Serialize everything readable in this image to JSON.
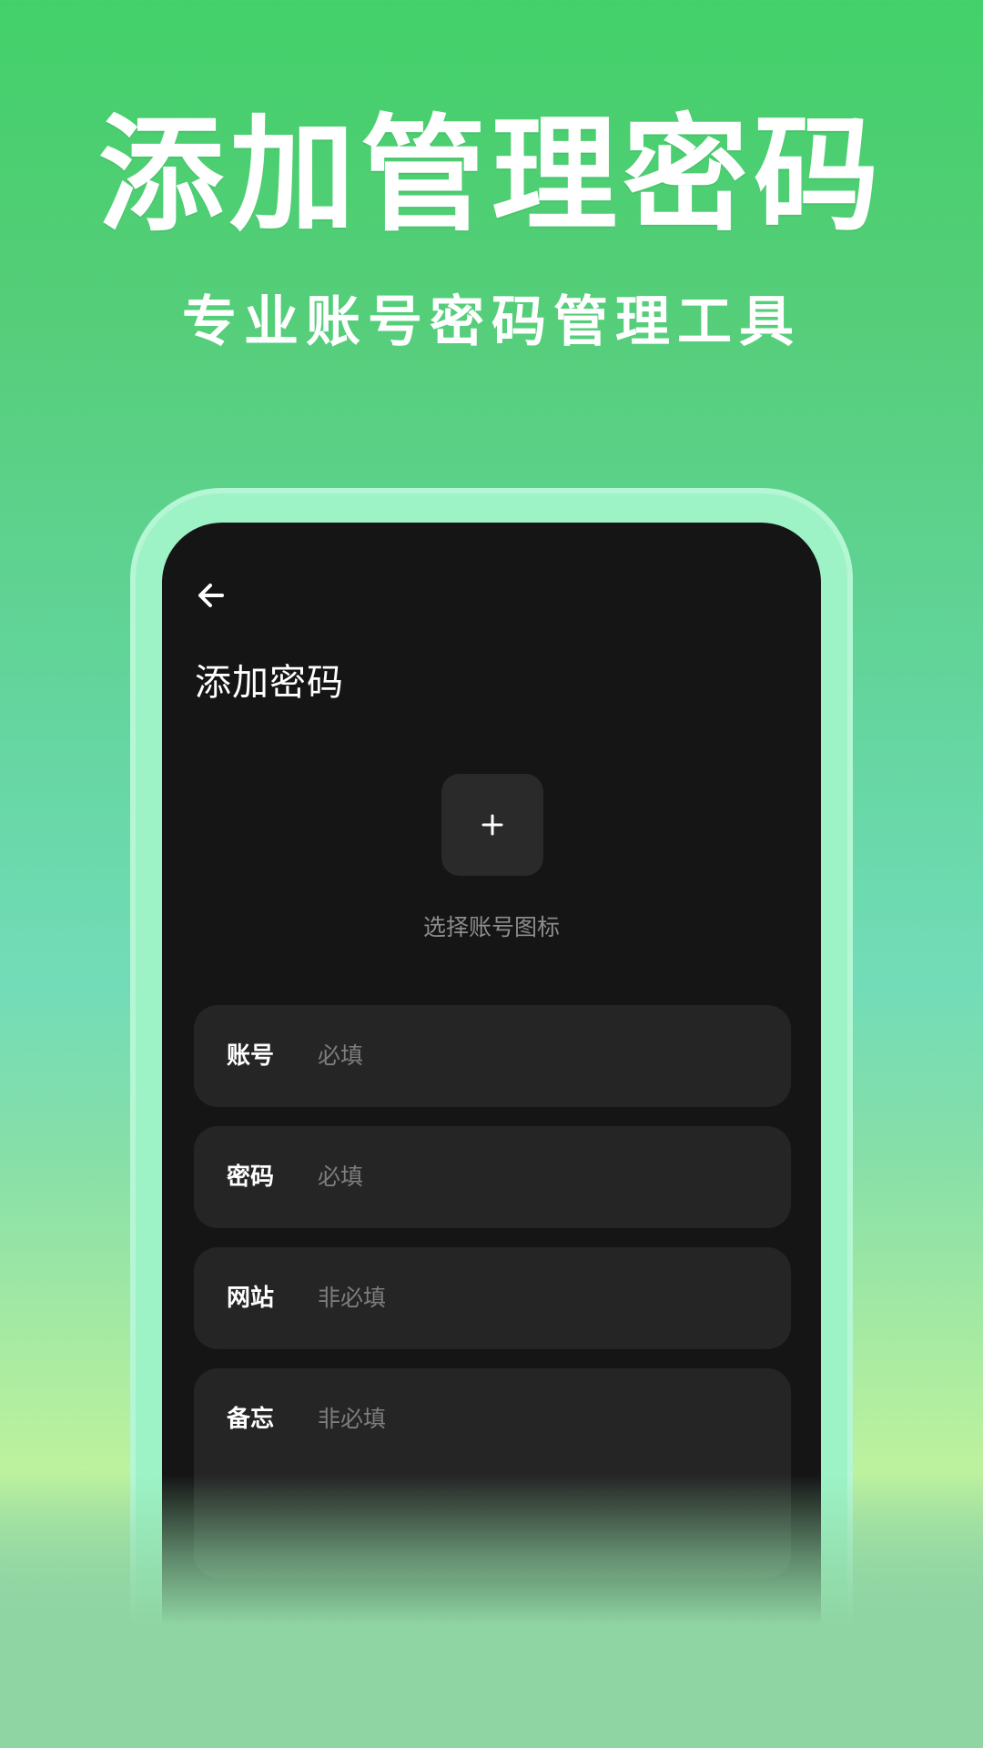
{
  "promo": {
    "headline": "添加管理密码",
    "subline": "专业账号密码管理工具"
  },
  "app": {
    "back_icon": "arrow-left-icon",
    "page_title": "添加密码",
    "icon_picker": {
      "icon": "plus-icon",
      "label": "选择账号图标"
    },
    "fields": [
      {
        "label": "账号",
        "placeholder": "必填"
      },
      {
        "label": "密码",
        "placeholder": "必填"
      },
      {
        "label": "网站",
        "placeholder": "非必填"
      },
      {
        "label": "备忘",
        "placeholder": "非必填"
      }
    ]
  },
  "colors": {
    "screen_bg": "#151515",
    "field_bg": "#252525",
    "frame": "#9df3c6",
    "accent_green": "#43d06a"
  }
}
